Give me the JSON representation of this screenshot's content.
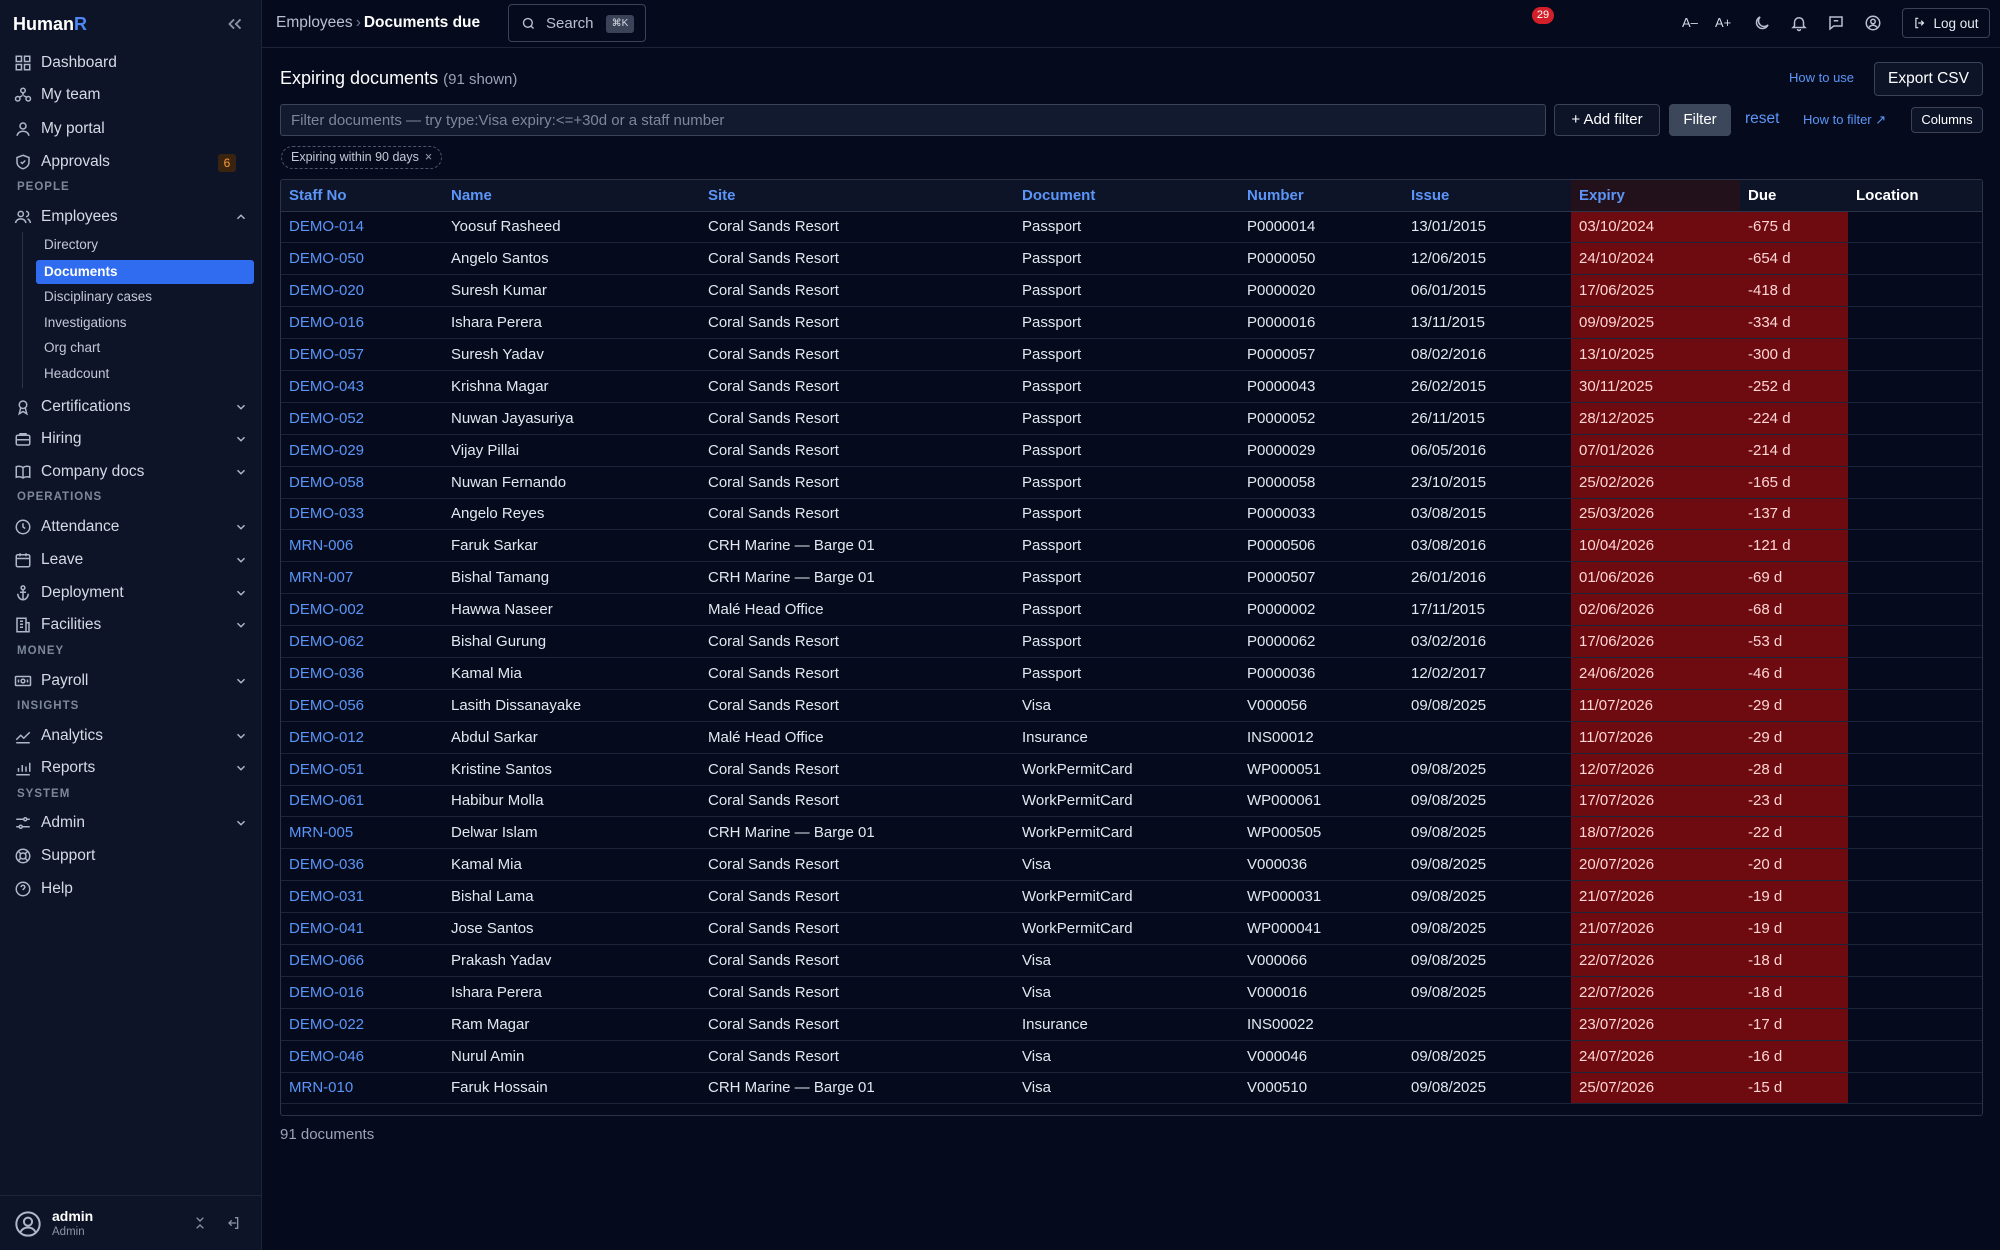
{
  "brand": {
    "main": "Human",
    "accent": "R"
  },
  "sidebar": {
    "items": [
      {
        "label": "Dashboard",
        "icon": "grid-icon"
      },
      {
        "label": "My team",
        "icon": "team-icon"
      },
      {
        "label": "My portal",
        "icon": "user-icon"
      },
      {
        "label": "Approvals",
        "icon": "shield-icon",
        "badge": "6"
      }
    ],
    "section_people": "PEOPLE",
    "employees": {
      "label": "Employees",
      "icon": "users-icon"
    },
    "sub_items": [
      "Directory",
      "Documents",
      "Disciplinary cases",
      "Investigations",
      "Org chart",
      "Headcount"
    ],
    "people_more": [
      {
        "label": "Certifications",
        "icon": "award-icon"
      },
      {
        "label": "Hiring",
        "icon": "briefcase-icon"
      },
      {
        "label": "Company docs",
        "icon": "book-icon"
      }
    ],
    "section_operations": "OPERATIONS",
    "operations": [
      {
        "label": "Attendance",
        "icon": "clock-icon"
      },
      {
        "label": "Leave",
        "icon": "calendar-icon"
      },
      {
        "label": "Deployment",
        "icon": "anchor-icon"
      },
      {
        "label": "Facilities",
        "icon": "building-icon"
      }
    ],
    "section_money": "MONEY",
    "payroll": {
      "label": "Payroll",
      "icon": "banknote-icon"
    },
    "section_insights": "INSIGHTS",
    "insights": [
      {
        "label": "Analytics",
        "icon": "trend-icon"
      },
      {
        "label": "Reports",
        "icon": "chart-icon"
      }
    ],
    "section_system": "SYSTEM",
    "system": [
      {
        "label": "Admin",
        "icon": "sliders-icon"
      },
      {
        "label": "Support",
        "icon": "lifebuoy-icon"
      },
      {
        "label": "Help",
        "icon": "help-icon"
      }
    ],
    "user": {
      "name": "admin",
      "role": "Admin"
    }
  },
  "topbar": {
    "breadcrumb_parent": "Employees",
    "breadcrumb_sep": "›",
    "breadcrumb_current": "Documents due",
    "search_label": "Search",
    "search_kbd": "⌘K",
    "font_smaller": "A–",
    "font_larger": "A+",
    "notification_count": "29",
    "logout_label": "Log out"
  },
  "main": {
    "title": "Expiring documents",
    "count_text": "(91 shown)",
    "how_to_use": "How to use",
    "export_label": "Export CSV",
    "filter_placeholder": "Filter documents — try type:Visa expiry:<=+30d or a staff number",
    "add_filter_label": "+ Add filter",
    "filter_label": "Filter",
    "reset_label": "reset",
    "how_to_filter": "How to filter ↗",
    "columns_label": "Columns",
    "chip_label": "Expiring within 90 days",
    "chip_close": "×",
    "footer_total": "91 documents"
  },
  "table": {
    "headers": [
      "Staff No",
      "Name",
      "Site",
      "Document",
      "Number",
      "Issue",
      "Expiry",
      "Due",
      "Location"
    ],
    "rows": [
      [
        "DEMO-014",
        "Yoosuf Rasheed",
        "Coral Sands Resort",
        "Passport",
        "P0000014",
        "13/01/2015",
        "03/10/2024",
        "-675 d",
        ""
      ],
      [
        "DEMO-050",
        "Angelo Santos",
        "Coral Sands Resort",
        "Passport",
        "P0000050",
        "12/06/2015",
        "24/10/2024",
        "-654 d",
        ""
      ],
      [
        "DEMO-020",
        "Suresh Kumar",
        "Coral Sands Resort",
        "Passport",
        "P0000020",
        "06/01/2015",
        "17/06/2025",
        "-418 d",
        ""
      ],
      [
        "DEMO-016",
        "Ishara Perera",
        "Coral Sands Resort",
        "Passport",
        "P0000016",
        "13/11/2015",
        "09/09/2025",
        "-334 d",
        ""
      ],
      [
        "DEMO-057",
        "Suresh Yadav",
        "Coral Sands Resort",
        "Passport",
        "P0000057",
        "08/02/2016",
        "13/10/2025",
        "-300 d",
        ""
      ],
      [
        "DEMO-043",
        "Krishna Magar",
        "Coral Sands Resort",
        "Passport",
        "P0000043",
        "26/02/2015",
        "30/11/2025",
        "-252 d",
        ""
      ],
      [
        "DEMO-052",
        "Nuwan Jayasuriya",
        "Coral Sands Resort",
        "Passport",
        "P0000052",
        "26/11/2015",
        "28/12/2025",
        "-224 d",
        ""
      ],
      [
        "DEMO-029",
        "Vijay Pillai",
        "Coral Sands Resort",
        "Passport",
        "P0000029",
        "06/05/2016",
        "07/01/2026",
        "-214 d",
        ""
      ],
      [
        "DEMO-058",
        "Nuwan Fernando",
        "Coral Sands Resort",
        "Passport",
        "P0000058",
        "23/10/2015",
        "25/02/2026",
        "-165 d",
        ""
      ],
      [
        "DEMO-033",
        "Angelo Reyes",
        "Coral Sands Resort",
        "Passport",
        "P0000033",
        "03/08/2015",
        "25/03/2026",
        "-137 d",
        ""
      ],
      [
        "MRN-006",
        "Faruk Sarkar",
        "CRH Marine — Barge 01",
        "Passport",
        "P0000506",
        "03/08/2016",
        "10/04/2026",
        "-121 d",
        ""
      ],
      [
        "MRN-007",
        "Bishal Tamang",
        "CRH Marine — Barge 01",
        "Passport",
        "P0000507",
        "26/01/2016",
        "01/06/2026",
        "-69 d",
        ""
      ],
      [
        "DEMO-002",
        "Hawwa Naseer",
        "Malé Head Office",
        "Passport",
        "P0000002",
        "17/11/2015",
        "02/06/2026",
        "-68 d",
        ""
      ],
      [
        "DEMO-062",
        "Bishal Gurung",
        "Coral Sands Resort",
        "Passport",
        "P0000062",
        "03/02/2016",
        "17/06/2026",
        "-53 d",
        ""
      ],
      [
        "DEMO-036",
        "Kamal Mia",
        "Coral Sands Resort",
        "Passport",
        "P0000036",
        "12/02/2017",
        "24/06/2026",
        "-46 d",
        ""
      ],
      [
        "DEMO-056",
        "Lasith Dissanayake",
        "Coral Sands Resort",
        "Visa",
        "V000056",
        "09/08/2025",
        "11/07/2026",
        "-29 d",
        ""
      ],
      [
        "DEMO-012",
        "Abdul Sarkar",
        "Malé Head Office",
        "Insurance",
        "INS00012",
        "",
        "11/07/2026",
        "-29 d",
        ""
      ],
      [
        "DEMO-051",
        "Kristine Santos",
        "Coral Sands Resort",
        "WorkPermitCard",
        "WP000051",
        "09/08/2025",
        "12/07/2026",
        "-28 d",
        ""
      ],
      [
        "DEMO-061",
        "Habibur Molla",
        "Coral Sands Resort",
        "WorkPermitCard",
        "WP000061",
        "09/08/2025",
        "17/07/2026",
        "-23 d",
        ""
      ],
      [
        "MRN-005",
        "Delwar Islam",
        "CRH Marine — Barge 01",
        "WorkPermitCard",
        "WP000505",
        "09/08/2025",
        "18/07/2026",
        "-22 d",
        ""
      ],
      [
        "DEMO-036",
        "Kamal Mia",
        "Coral Sands Resort",
        "Visa",
        "V000036",
        "09/08/2025",
        "20/07/2026",
        "-20 d",
        ""
      ],
      [
        "DEMO-031",
        "Bishal Lama",
        "Coral Sands Resort",
        "WorkPermitCard",
        "WP000031",
        "09/08/2025",
        "21/07/2026",
        "-19 d",
        ""
      ],
      [
        "DEMO-041",
        "Jose Santos",
        "Coral Sands Resort",
        "WorkPermitCard",
        "WP000041",
        "09/08/2025",
        "21/07/2026",
        "-19 d",
        ""
      ],
      [
        "DEMO-066",
        "Prakash Yadav",
        "Coral Sands Resort",
        "Visa",
        "V000066",
        "09/08/2025",
        "22/07/2026",
        "-18 d",
        ""
      ],
      [
        "DEMO-016",
        "Ishara Perera",
        "Coral Sands Resort",
        "Visa",
        "V000016",
        "09/08/2025",
        "22/07/2026",
        "-18 d",
        ""
      ],
      [
        "DEMO-022",
        "Ram Magar",
        "Coral Sands Resort",
        "Insurance",
        "INS00022",
        "",
        "23/07/2026",
        "-17 d",
        ""
      ],
      [
        "DEMO-046",
        "Nurul Amin",
        "Coral Sands Resort",
        "Visa",
        "V000046",
        "09/08/2025",
        "24/07/2026",
        "-16 d",
        ""
      ],
      [
        "MRN-010",
        "Faruk Hossain",
        "CRH Marine — Barge 01",
        "Visa",
        "V000510",
        "09/08/2025",
        "25/07/2026",
        "-15 d",
        ""
      ]
    ]
  },
  "colors": {
    "background": "#050b1d",
    "sidebar": "#0d1427",
    "accent": "#2f6cf0",
    "link": "#5b95f7",
    "overdue": "#6e0b10",
    "notification": "#d21f2a",
    "badge": "#ff9a3d"
  }
}
